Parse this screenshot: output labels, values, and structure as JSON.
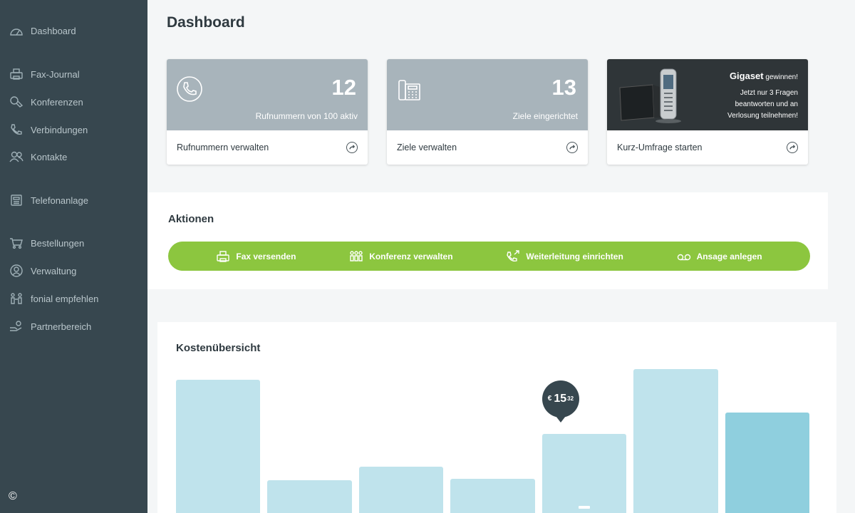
{
  "sidebar": {
    "items": [
      {
        "label": "Dashboard",
        "icon": "dashboard-icon"
      },
      {
        "label": "Fax-Journal",
        "icon": "fax-icon"
      },
      {
        "label": "Konferenzen",
        "icon": "conference-icon"
      },
      {
        "label": "Verbindungen",
        "icon": "phone-icon"
      },
      {
        "label": "Kontakte",
        "icon": "contacts-icon"
      },
      {
        "label": "Telefonanlage",
        "icon": "phone-system-icon"
      },
      {
        "label": "Bestellungen",
        "icon": "cart-icon"
      },
      {
        "label": "Verwaltung",
        "icon": "user-icon"
      },
      {
        "label": "fonial empfehlen",
        "icon": "recommend-icon"
      },
      {
        "label": "Partnerbereich",
        "icon": "partner-icon"
      }
    ],
    "copyright": "©"
  },
  "page": {
    "title": "Dashboard"
  },
  "cards": [
    {
      "number": "12",
      "subtitle": "Rufnummern von 100 aktiv",
      "link": "Rufnummern verwalten",
      "icon": "phone-circle-icon"
    },
    {
      "number": "13",
      "subtitle": "Ziele eingerichtet",
      "link": "Ziele verwalten",
      "icon": "desk-phone-icon"
    },
    {
      "brand": "Gigaset",
      "brand_sub": "gewinnen!",
      "line1": "Jetzt nur 3 Fragen",
      "line2": "beantworten und an",
      "line3": "Verlosung teilnehmen!",
      "link": "Kurz-Umfrage starten",
      "icon": "gigaset-phone-icon"
    }
  ],
  "aktionen": {
    "title": "Aktionen",
    "items": [
      {
        "label": "Fax versenden",
        "icon": "fax-icon"
      },
      {
        "label": "Konferenz verwalten",
        "icon": "conference-icon"
      },
      {
        "label": "Weiterleitung einrichten",
        "icon": "forward-call-icon"
      },
      {
        "label": "Ansage anlegen",
        "icon": "voicemail-icon"
      }
    ],
    "color": "#8cc63f"
  },
  "kosten": {
    "title": "Kostenübersicht",
    "tooltip": {
      "currency": "€",
      "amount": "15",
      "cents": "32"
    }
  },
  "chart_data": {
    "type": "bar",
    "categories": [],
    "values": [
      0.89,
      0.22,
      0.31,
      0.23,
      0.53,
      0.96,
      0.67
    ],
    "highlight_index": 6,
    "selected_index": 4,
    "colors": {
      "bar": "#bfe3ec",
      "highlight": "#8fcfde",
      "tooltip": "#37474f"
    }
  }
}
